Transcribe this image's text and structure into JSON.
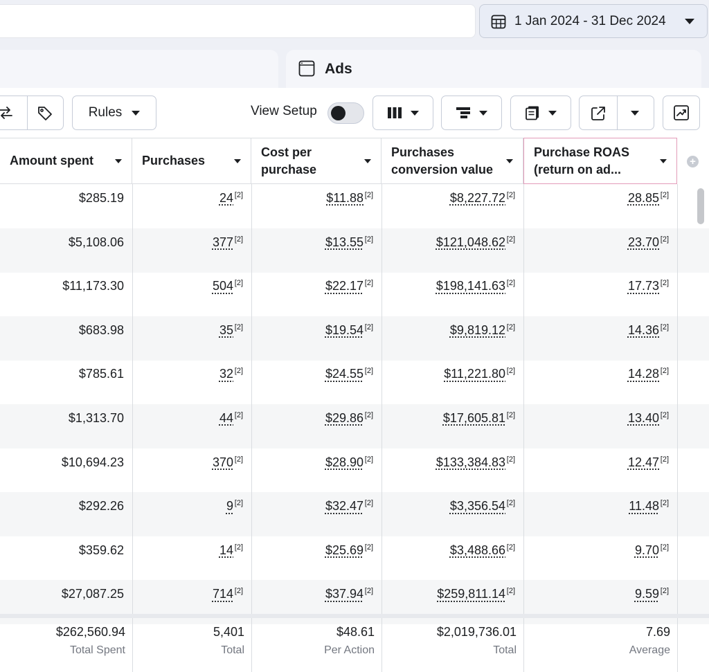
{
  "date_range": {
    "label": "1 Jan 2024 - 31 Dec 2024",
    "icon": "calendar-icon"
  },
  "tabs": {
    "ads_label": "Ads",
    "ads_icon": "ad-frame-icon"
  },
  "toolbar": {
    "rules_label": "Rules",
    "view_setup_label": "View Setup",
    "view_setup_on": false,
    "icons": [
      "swap-icon",
      "tag-icon",
      "columns-icon",
      "breakdown-icon",
      "reports-icon",
      "export-icon",
      "chart-icon"
    ]
  },
  "table": {
    "columns": [
      {
        "label": "Amount spent"
      },
      {
        "label": "Purchases"
      },
      {
        "label": "Cost per purchase"
      },
      {
        "label": "Purchases conversion value"
      },
      {
        "label": "Purchase ROAS (return on ad..."
      }
    ],
    "footnote": "[2]",
    "rows": [
      {
        "amount_spent": "$285.19",
        "purchases": "24",
        "cost_per_purchase": "$11.88",
        "conversion_value": "$8,227.72",
        "roas": "28.85"
      },
      {
        "amount_spent": "$5,108.06",
        "purchases": "377",
        "cost_per_purchase": "$13.55",
        "conversion_value": "$121,048.62",
        "roas": "23.70"
      },
      {
        "amount_spent": "$11,173.30",
        "purchases": "504",
        "cost_per_purchase": "$22.17",
        "conversion_value": "$198,141.63",
        "roas": "17.73"
      },
      {
        "amount_spent": "$683.98",
        "purchases": "35",
        "cost_per_purchase": "$19.54",
        "conversion_value": "$9,819.12",
        "roas": "14.36"
      },
      {
        "amount_spent": "$785.61",
        "purchases": "32",
        "cost_per_purchase": "$24.55",
        "conversion_value": "$11,221.80",
        "roas": "14.28"
      },
      {
        "amount_spent": "$1,313.70",
        "purchases": "44",
        "cost_per_purchase": "$29.86",
        "conversion_value": "$17,605.81",
        "roas": "13.40"
      },
      {
        "amount_spent": "$10,694.23",
        "purchases": "370",
        "cost_per_purchase": "$28.90",
        "conversion_value": "$133,384.83",
        "roas": "12.47"
      },
      {
        "amount_spent": "$292.26",
        "purchases": "9",
        "cost_per_purchase": "$32.47",
        "conversion_value": "$3,356.54",
        "roas": "11.48"
      },
      {
        "amount_spent": "$359.62",
        "purchases": "14",
        "cost_per_purchase": "$25.69",
        "conversion_value": "$3,488.66",
        "roas": "9.70"
      },
      {
        "amount_spent": "$27,087.25",
        "purchases": "714",
        "cost_per_purchase": "$37.94",
        "conversion_value": "$259,811.14",
        "roas": "9.59"
      }
    ],
    "totals": {
      "amount_spent": {
        "value": "$262,560.94",
        "label": "Total Spent"
      },
      "purchases": {
        "value": "5,401",
        "label": "Total"
      },
      "cost_per_purchase": {
        "value": "$48.61",
        "label": "Per Action"
      },
      "conversion_value": {
        "value": "$2,019,736.01",
        "label": "Total"
      },
      "roas": {
        "value": "7.69",
        "label": "Average"
      }
    }
  },
  "colors": {
    "accent_selected_column": "#e39bb9",
    "text": "#1c1e21",
    "muted": "#737780"
  }
}
